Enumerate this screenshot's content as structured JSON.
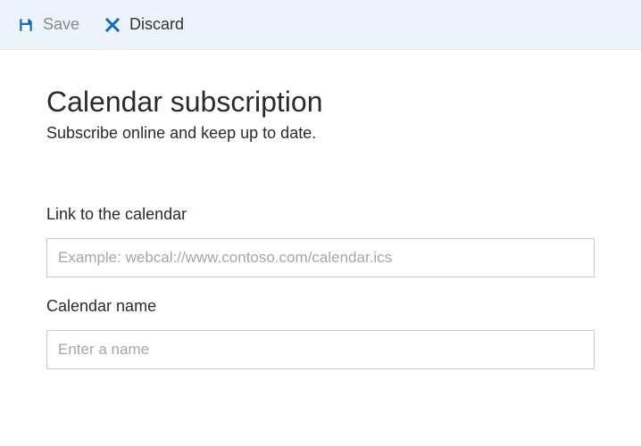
{
  "toolbar": {
    "save_label": "Save",
    "discard_label": "Discard"
  },
  "main": {
    "title": "Calendar subscription",
    "subtitle": "Subscribe online and keep up to date.",
    "fields": {
      "link": {
        "label": "Link to the calendar",
        "placeholder": "Example: webcal://www.contoso.com/calendar.ics",
        "value": ""
      },
      "name": {
        "label": "Calendar name",
        "placeholder": "Enter a name",
        "value": ""
      }
    }
  }
}
